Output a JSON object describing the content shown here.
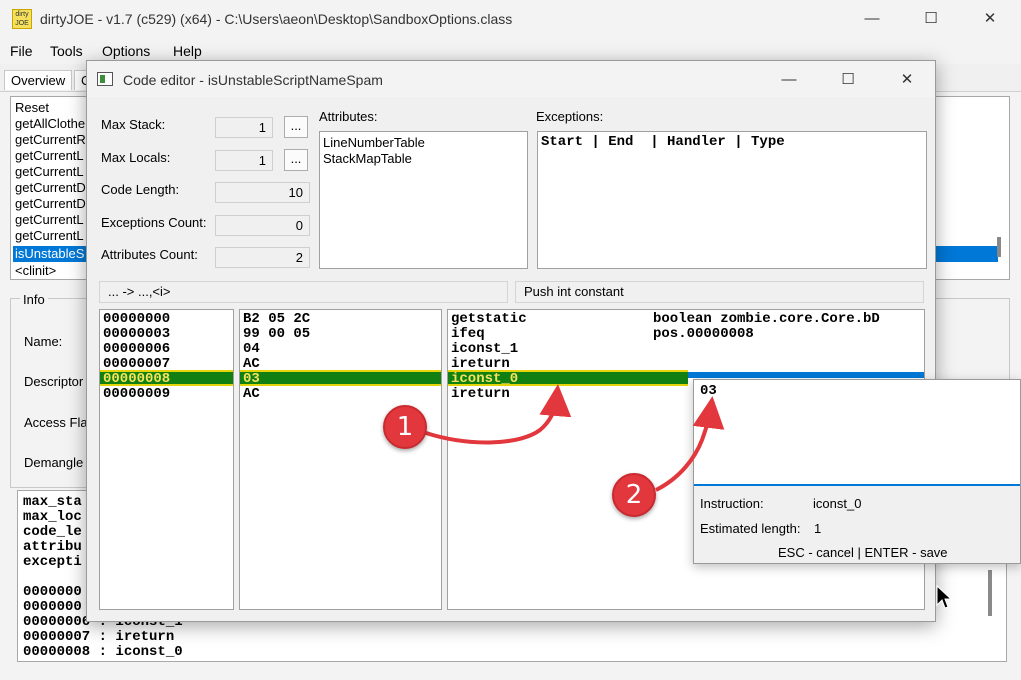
{
  "window": {
    "title": "dirtyJOE - v1.7 (c529) (x64) - C:\\Users\\aeon\\Desktop\\SandboxOptions.class",
    "icon_text": "dirty JOE",
    "minimize": "—",
    "maximize": "☐",
    "close": "✕"
  },
  "menu": [
    "File",
    "Tools",
    "Options",
    "Help"
  ],
  "main_tabs": [
    "Overview",
    "C"
  ],
  "methods": [
    "Reset",
    "getAllClothe",
    "getCurrentR",
    "getCurrentL",
    "getCurrentL",
    "getCurrentD",
    "getCurrentD",
    "getCurrentL",
    "getCurrentL",
    "isUnstableS",
    "<clinit>"
  ],
  "info": {
    "title": "Info",
    "labels": [
      "Name:",
      "Descriptor",
      "Access Fla",
      "Demangle"
    ]
  },
  "summary_lines": [
    "max_sta",
    "max_loc",
    "code_le",
    "attribu",
    "excepti",
    "",
    "0000000",
    "0000000",
    "00000006 : iconst_1",
    "00000007 : ireturn",
    "00000008 : iconst_0"
  ],
  "editor": {
    "title": "Code editor - isUnstableScriptNameSpam",
    "fields": [
      {
        "label": "Max Stack:",
        "value": "1",
        "has_button": true
      },
      {
        "label": "Max Locals:",
        "value": "1",
        "has_button": true
      },
      {
        "label": "Code Length:",
        "value": "10",
        "has_button": false
      },
      {
        "label": "Exceptions Count:",
        "value": "0",
        "has_button": false
      },
      {
        "label": "Attributes Count:",
        "value": "2",
        "has_button": false
      }
    ],
    "ellipsis": "...",
    "attributes_label": "Attributes:",
    "attributes": [
      "LineNumberTable",
      "StackMapTable"
    ],
    "exceptions_label": "Exceptions:",
    "exceptions_header": "Start | End  | Handler | Type",
    "stack_hint": "... -> ...,<i>",
    "desc_hint": "Push int constant",
    "rows": [
      {
        "offset": "00000000",
        "bytes": "B2 05 2C",
        "mnemonic": "getstatic",
        "operand": "boolean zombie.core.Core.bD"
      },
      {
        "offset": "00000003",
        "bytes": "99 00 05",
        "mnemonic": "ifeq",
        "operand": "pos.00000008"
      },
      {
        "offset": "00000006",
        "bytes": "04",
        "mnemonic": "iconst_1",
        "operand": ""
      },
      {
        "offset": "00000007",
        "bytes": "AC",
        "mnemonic": "ireturn",
        "operand": ""
      },
      {
        "offset": "00000008",
        "bytes": "03",
        "mnemonic": "iconst_0",
        "operand": ""
      },
      {
        "offset": "00000009",
        "bytes": "AC",
        "mnemonic": "ireturn",
        "operand": ""
      }
    ],
    "selected_row": 4
  },
  "popup": {
    "value": "03",
    "instruction_label": "Instruction:",
    "instruction_value": "iconst_0",
    "length_label": "Estimated length:",
    "length_value": "1",
    "help": "ESC - cancel | ENTER - save"
  },
  "annotations": [
    "1",
    "2"
  ],
  "colors": {
    "selection": "#127f12",
    "selection_text": "#f5e35a",
    "highlight_blue": "#0078d7",
    "annotation_red": "#e2373c"
  }
}
